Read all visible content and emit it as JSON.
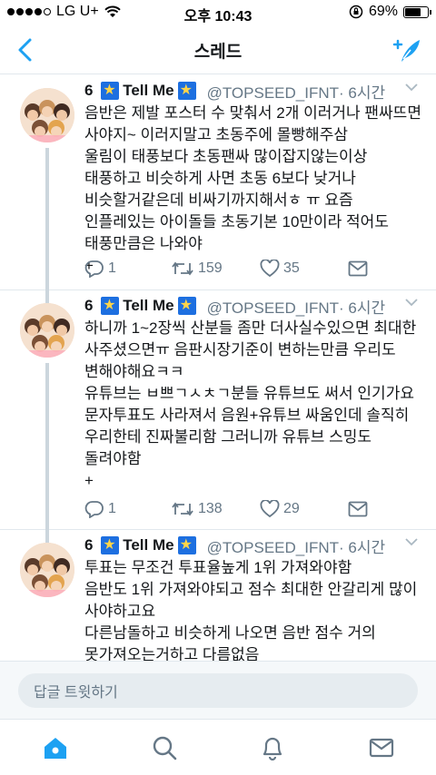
{
  "status_bar": {
    "carrier": "LG U+",
    "time": "오후 10:43",
    "battery_percent": "69%",
    "battery_level": 0.69
  },
  "nav": {
    "title": "스레드",
    "back_icon": "chevron-left-icon",
    "compose_icon": "compose-tweet-icon"
  },
  "tweets": [
    {
      "name": "6",
      "display_suffix": "Tell Me",
      "handle": "@TOPSEED_IFNT",
      "time": "· 6시간",
      "text": "음반은 제발 포스터 수 맞춰서 2개 이러거나 팬싸뜨면 사야지~ 이러지말고 초동주에 몰빵해주삼\n울림이 태풍보다 초동팬싸 많이잡지않는이상 태풍하고 비슷하게 사면 초동 6보다 낮거나 비슷할거같은데 비싸기까지해서ㅎ ㅠ 요즘 인플레있는 아이돌들 초동기본 10만이라 적어도 태풍만큼은 나와야\n+",
      "replies": "1",
      "retweets": "159",
      "likes": "35"
    },
    {
      "name": "6",
      "display_suffix": "Tell Me",
      "handle": "@TOPSEED_IFNT",
      "time": "· 6시간",
      "text": "하니까 1~2장씩 산분들 좀만 더사실수있으면 최대한 사주셨으면ㅠ 음판시장기준이 변하는만큼 우리도 변해야해요ㅋㅋ\n유튜브는 ㅂ쁘ㄱㅅㅊㄱ분들 유튜브도 써서 인기가요 문자투표도 사라져서 음원+유튜브 싸움인데 솔직히 우리한테 진짜불리함 그러니까 유튜브 스밍도 돌려야함\n+",
      "replies": "1",
      "retweets": "138",
      "likes": "29"
    },
    {
      "name": "6",
      "display_suffix": "Tell Me",
      "handle": "@TOPSEED_IFNT",
      "time": "· 6시간",
      "text": "투표는 무조건 투표율높게 1위 가져와야함\n음반도 1위 가져와야되고 점수 최대한 안갈리게 많이 사야하고요\n다른남돌하고 비슷하게 나오면 음반 점수 거의 못가져오는거하고 다름없음\n음원이 너무쎄서라도 나오니까 최대한 할수있는 거 다",
      "replies": "",
      "retweets": "",
      "likes": ""
    }
  ],
  "reply_bar": {
    "placeholder": "답글 트윗하기"
  },
  "tab_bar": {
    "items": [
      "home-icon",
      "search-icon",
      "notifications-icon",
      "messages-icon"
    ],
    "active_color": "#1da1f2"
  },
  "colors": {
    "accent": "#1da1f2",
    "text": "#14171a",
    "muted": "#657786",
    "border": "#e1e8ed"
  }
}
